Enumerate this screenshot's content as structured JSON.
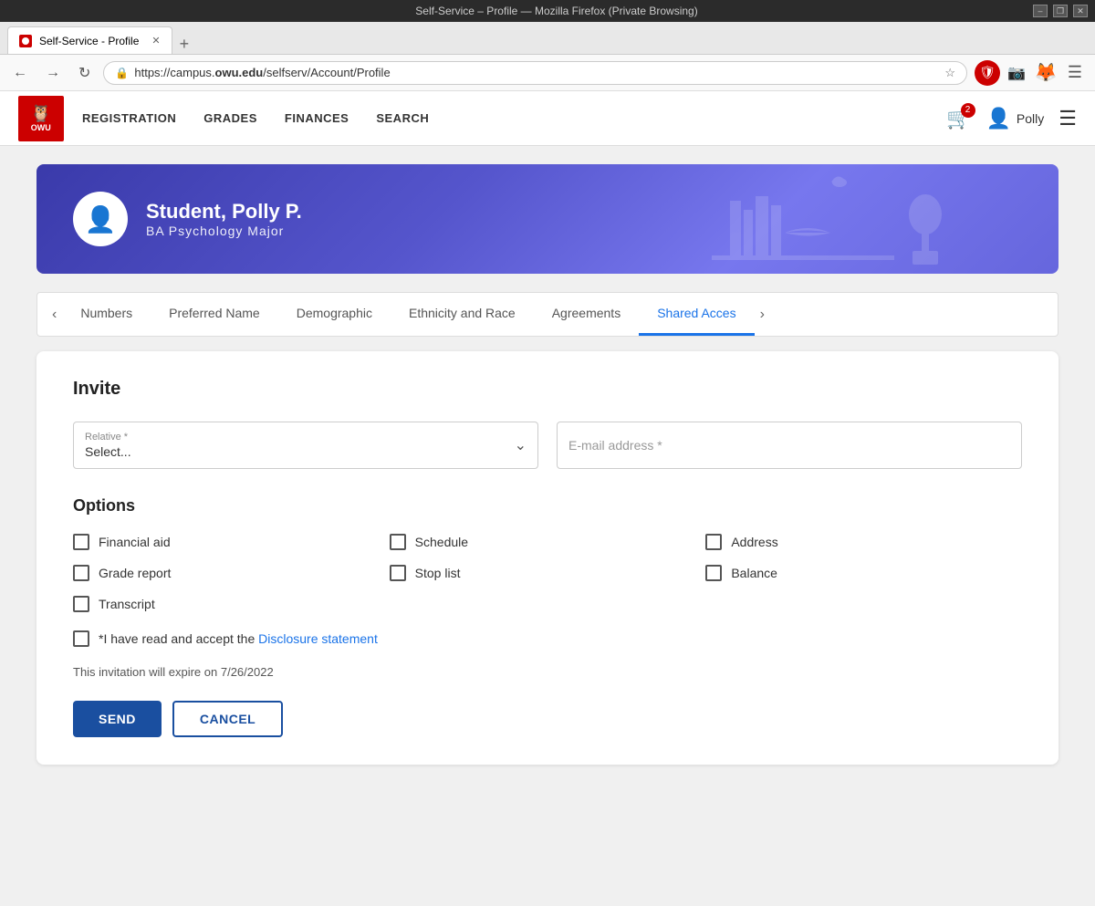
{
  "browser": {
    "titlebar": "Self-Service – Profile — Mozilla Firefox (Private Browsing)",
    "tab_title": "Self-Service - Profile",
    "url": "https://campus.owu.edu/selfserv/Account/Profile",
    "win_min": "–",
    "win_restore": "❐",
    "win_close": "✕"
  },
  "header": {
    "logo_text": "OWU",
    "nav": [
      "REGISTRATION",
      "GRADES",
      "FINANCES",
      "SEARCH"
    ],
    "cart_count": "2",
    "user_name": "Polly",
    "menu_icon": "☰"
  },
  "banner": {
    "student_name": "Student, Polly P.",
    "student_major": "BA  Psychology  Major"
  },
  "tabs": {
    "left_arrow": "‹",
    "right_arrow": "›",
    "items": [
      {
        "label": "Numbers",
        "active": false
      },
      {
        "label": "Preferred Name",
        "active": false
      },
      {
        "label": "Demographic",
        "active": false
      },
      {
        "label": "Ethnicity and Race",
        "active": false
      },
      {
        "label": "Agreements",
        "active": false
      },
      {
        "label": "Shared Acces",
        "active": true
      }
    ]
  },
  "invite": {
    "section_title": "Invite",
    "relative_label": "Relative *",
    "relative_placeholder": "Select...",
    "email_placeholder": "E-mail address *",
    "options_title": "Options",
    "options": [
      {
        "id": "financial_aid",
        "label": "Financial aid"
      },
      {
        "id": "schedule",
        "label": "Schedule"
      },
      {
        "id": "address",
        "label": "Address"
      },
      {
        "id": "grade_report",
        "label": "Grade report"
      },
      {
        "id": "stop_list",
        "label": "Stop list"
      },
      {
        "id": "balance",
        "label": "Balance"
      },
      {
        "id": "transcript",
        "label": "Transcript"
      }
    ],
    "disclosure_text": "*I have read and accept the",
    "disclosure_link_text": "Disclosure statement",
    "expiry_text": "This invitation will expire on 7/26/2022",
    "btn_send": "SEND",
    "btn_cancel": "CANCEL"
  }
}
